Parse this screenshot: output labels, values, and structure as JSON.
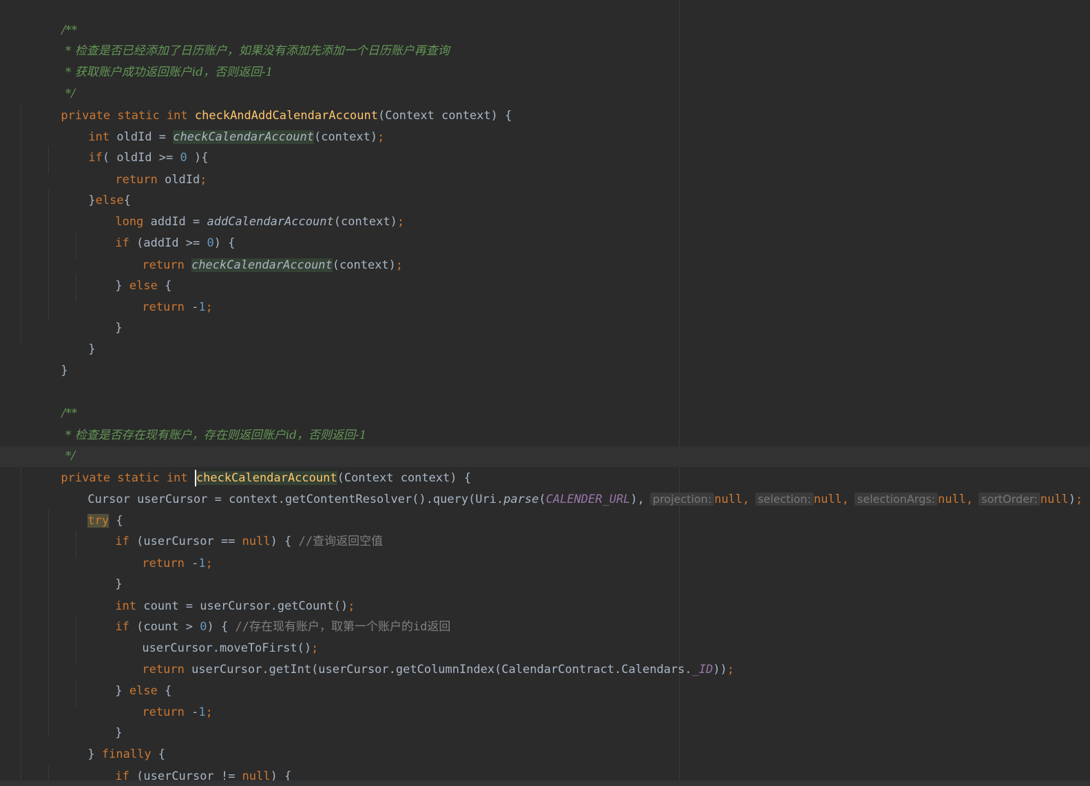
{
  "editor": {
    "language": "Java",
    "theme": "Darcula",
    "colors": {
      "background": "#2b2b2b",
      "keyword": "#cc7832",
      "doc_comment": "#629755",
      "line_comment": "#808080",
      "method_declaration": "#ffc66d",
      "number": "#6897bb",
      "constant": "#9876aa",
      "plain": "#a9b7c6"
    }
  },
  "code": {
    "doc1": {
      "open": "/**",
      "line1": " * 检查是否已经添加了日历账户，如果没有添加先添加一个日历账户再查询",
      "line2": " * 获取账户成功返回账户id，否则返回-1",
      "close": " */"
    },
    "m1": {
      "modifiers": "private static int ",
      "name": "checkAndAddCalendarAccount",
      "params": "(Context context) {"
    },
    "l_int": "int ",
    "l_oldId_assign": "oldId = ",
    "l_checkCalendarAccount": "checkCalendarAccount",
    "l_context_call": "(context)",
    "l_semi": ";",
    "l_if": "if",
    "l_if_cond1": "( oldId >= ",
    "l_zero": "0",
    "l_if_close1": " ){",
    "l_return": "return ",
    "l_oldId": "oldId",
    "l_close_else": "}",
    "l_else": "else",
    "l_open": "{",
    "l_long": "long ",
    "l_addId_assign": "addId = ",
    "l_addCalendarAccount": "addCalendarAccount",
    "l_if_sp": "if ",
    "l_addId_cond": "(addId >= ",
    "l_cond_close": ") {",
    "l_close_b": "} ",
    "l_else2": "else",
    "l_sp_open": " {",
    "l_minus": "-",
    "l_one": "1",
    "l_brace": "}",
    "doc2": {
      "open": "/**",
      "line1": " * 检查是否存在现有账户，存在则返回账户id，否则返回-1",
      "close": " */"
    },
    "m2": {
      "modifiers": "private static int ",
      "name": "checkCalendarAccount",
      "params": "(Context context) {"
    },
    "cursor_line": {
      "prefix": "Cursor userCursor = context.getContentResolver().query(Uri.",
      "parse": "parse",
      "paren": "(",
      "const": "CALENDER_URL",
      "close": "),",
      "hint_projection": "projection:",
      "hint_selection": "selection:",
      "hint_selectionArgs": "selectionArgs:",
      "hint_sortOrder": "sortOrder:",
      "null": "null",
      "comma": ",",
      "end_paren": ")",
      "semi": ";"
    },
    "try_kw": "try",
    "userCursor_cond": "(userCursor == ",
    "null_kw": "null",
    "cmt_empty": "//查询返回空值",
    "count_assign": "count = userCursor.getCount()",
    "count_cond": "(count > ",
    "cmt_first": "//存在现有账户，取第一个账户的id返回",
    "moveToFirst": "userCursor.moveToFirst()",
    "getInt_prefix": "userCursor.getInt(userCursor.getColumnIndex(CalendarContract.Calendars.",
    "id_const": "_ID",
    "getInt_close": "))",
    "finally_kw": "finally",
    "userCursor_ne": "(userCursor != "
  }
}
